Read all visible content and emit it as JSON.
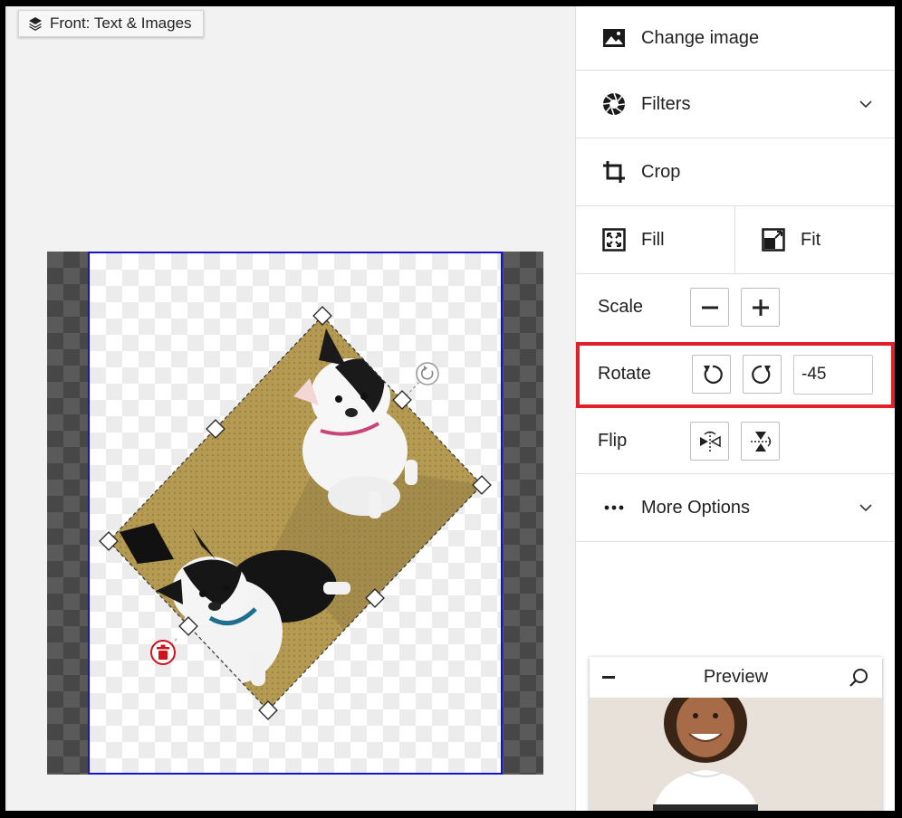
{
  "layer_chip": {
    "label": "Front: Text & Images",
    "icon": "layers-icon"
  },
  "panel": {
    "change_image": {
      "label": "Change image",
      "icon": "image-icon"
    },
    "filters": {
      "label": "Filters",
      "icon": "aperture-icon"
    },
    "crop": {
      "label": "Crop",
      "icon": "crop-icon"
    },
    "fill": {
      "label": "Fill",
      "icon": "fill-icon"
    },
    "fit": {
      "label": "Fit",
      "icon": "fit-icon"
    },
    "scale": {
      "label": "Scale",
      "minus": "−",
      "plus": "+"
    },
    "rotate": {
      "label": "Rotate",
      "value": "-45"
    },
    "flip": {
      "label": "Flip"
    },
    "more_options": {
      "label": "More Options",
      "icon": "more-horizontal-icon"
    }
  },
  "preview": {
    "title": "Preview"
  },
  "colors": {
    "printable_border": "#1515c8",
    "highlight": "#e0202b",
    "delete": "#d0121b"
  }
}
